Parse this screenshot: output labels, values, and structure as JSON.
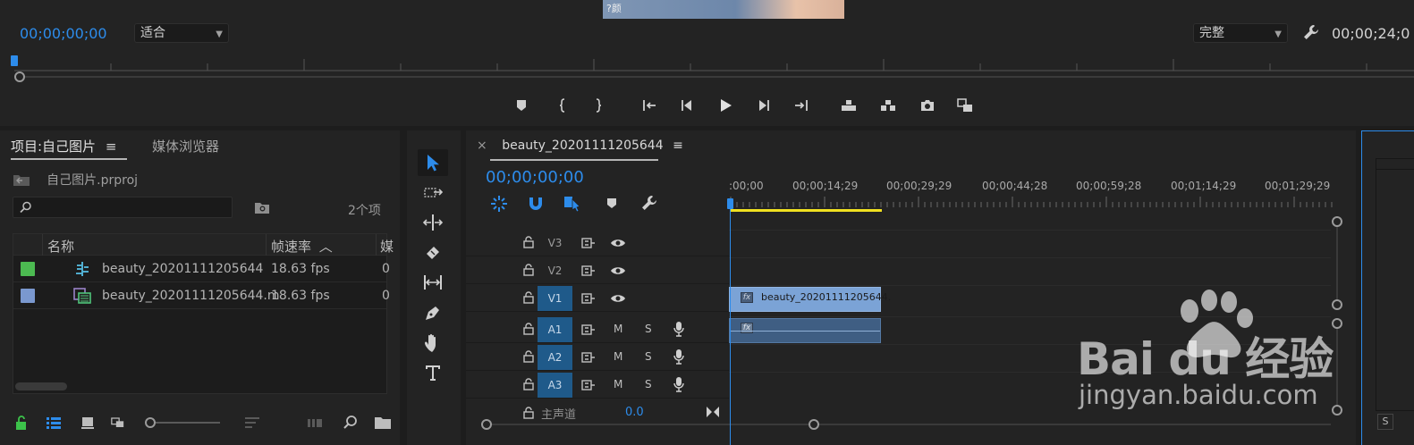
{
  "program_monitor": {
    "video_caption": "?颜",
    "timecode": "00;00;00;00",
    "fit_option": "适合",
    "quality_option": "完整",
    "duration": "00;00;24;0"
  },
  "project_panel": {
    "tab_project": "项目:自己图片",
    "tab_media_browser": "媒体浏览器",
    "project_file": "自己图片.prproj",
    "search_placeholder": "",
    "item_count": "2个项",
    "columns": {
      "name": "名称",
      "fps": "帧速率",
      "cut": "媒"
    },
    "items": [
      {
        "name": "beauty_20201111205644",
        "fps": "18.63 fps",
        "cut": "0",
        "color": "#4cba51"
      },
      {
        "name": "beauty_20201111205644.m",
        "fps": "18.63 fps",
        "cut": "0",
        "color": "#7a98cf"
      }
    ]
  },
  "timeline": {
    "sequence_name": "beauty_20201111205644",
    "close_label": "×",
    "timecode": "00;00;00;00",
    "ruler_labels": [
      ":00;00",
      "00;00;14;29",
      "00;00;29;29",
      "00;00;44;28",
      "00;00;59;28",
      "00;01;14;29",
      "00;01;29;29"
    ],
    "tracks": [
      {
        "name": "V3",
        "kind": "video",
        "targeted": false
      },
      {
        "name": "V2",
        "kind": "video",
        "targeted": false
      },
      {
        "name": "V1",
        "kind": "video",
        "targeted": true
      },
      {
        "name": "A1",
        "kind": "audio",
        "targeted": true
      },
      {
        "name": "A2",
        "kind": "audio",
        "targeted": true
      },
      {
        "name": "A3",
        "kind": "audio",
        "targeted": true
      }
    ],
    "mute_label": "M",
    "solo_label": "S",
    "video_clip_name": "beauty_20201111205644.",
    "fx_label": "fx",
    "master_label": "主声道",
    "master_value": "0.0"
  },
  "right_panel": {
    "s_label": "S"
  },
  "watermark": {
    "brand": "Bai  du 经验",
    "url": "jingyan.baidu.com"
  },
  "colors": {
    "accent": "#2d8ceb",
    "video_clip": "#7ba3d6",
    "audio_clip": "#3f5e83",
    "work_area": "#f0e020",
    "track_target": "#1f5a8a"
  }
}
